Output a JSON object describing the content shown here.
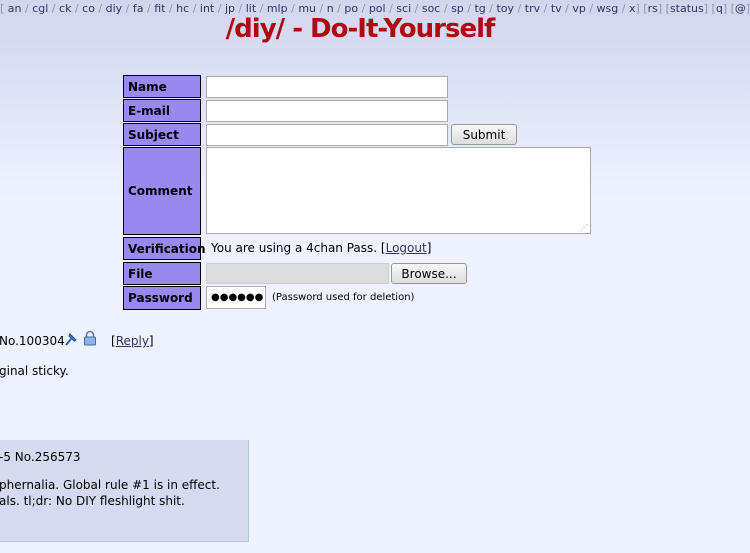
{
  "boardnav": {
    "boards": [
      "an",
      "cgl",
      "ck",
      "co",
      "diy",
      "fa",
      "fit",
      "hc",
      "int",
      "jp",
      "lit",
      "mlp",
      "mu",
      "n",
      "po",
      "pol",
      "sci",
      "soc",
      "sp",
      "tg",
      "toy",
      "trv",
      "tv",
      "vp",
      "wsg",
      "x"
    ],
    "extras": [
      "rs",
      "status",
      "q",
      "@"
    ]
  },
  "header": {
    "title": "/diy/ - Do-It-Yourself"
  },
  "form": {
    "name_label": "Name",
    "email_label": "E-mail",
    "subject_label": "Subject",
    "submit_label": "Submit",
    "comment_label": "Comment",
    "verification_label": "Verification",
    "verification_text": "You are using a 4chan Pass. [",
    "logout_label": "Logout",
    "verification_close": "]",
    "file_label": "File",
    "browse_label": "Browse...",
    "password_label": "Password",
    "password_value": "●●●●●●",
    "password_hint": "(Password used for deletion)"
  },
  "thread": {
    "post_number": "No.100304",
    "reply_open": "[",
    "reply_label": "Reply",
    "reply_close": "]",
    "body": "ginal sticky."
  },
  "reply": {
    "header": "-5 No.256573",
    "line1": "phernalia. Global rule #1 is in effect.",
    "line2": "als. tl;dr: No DIY fleshlight shit."
  }
}
